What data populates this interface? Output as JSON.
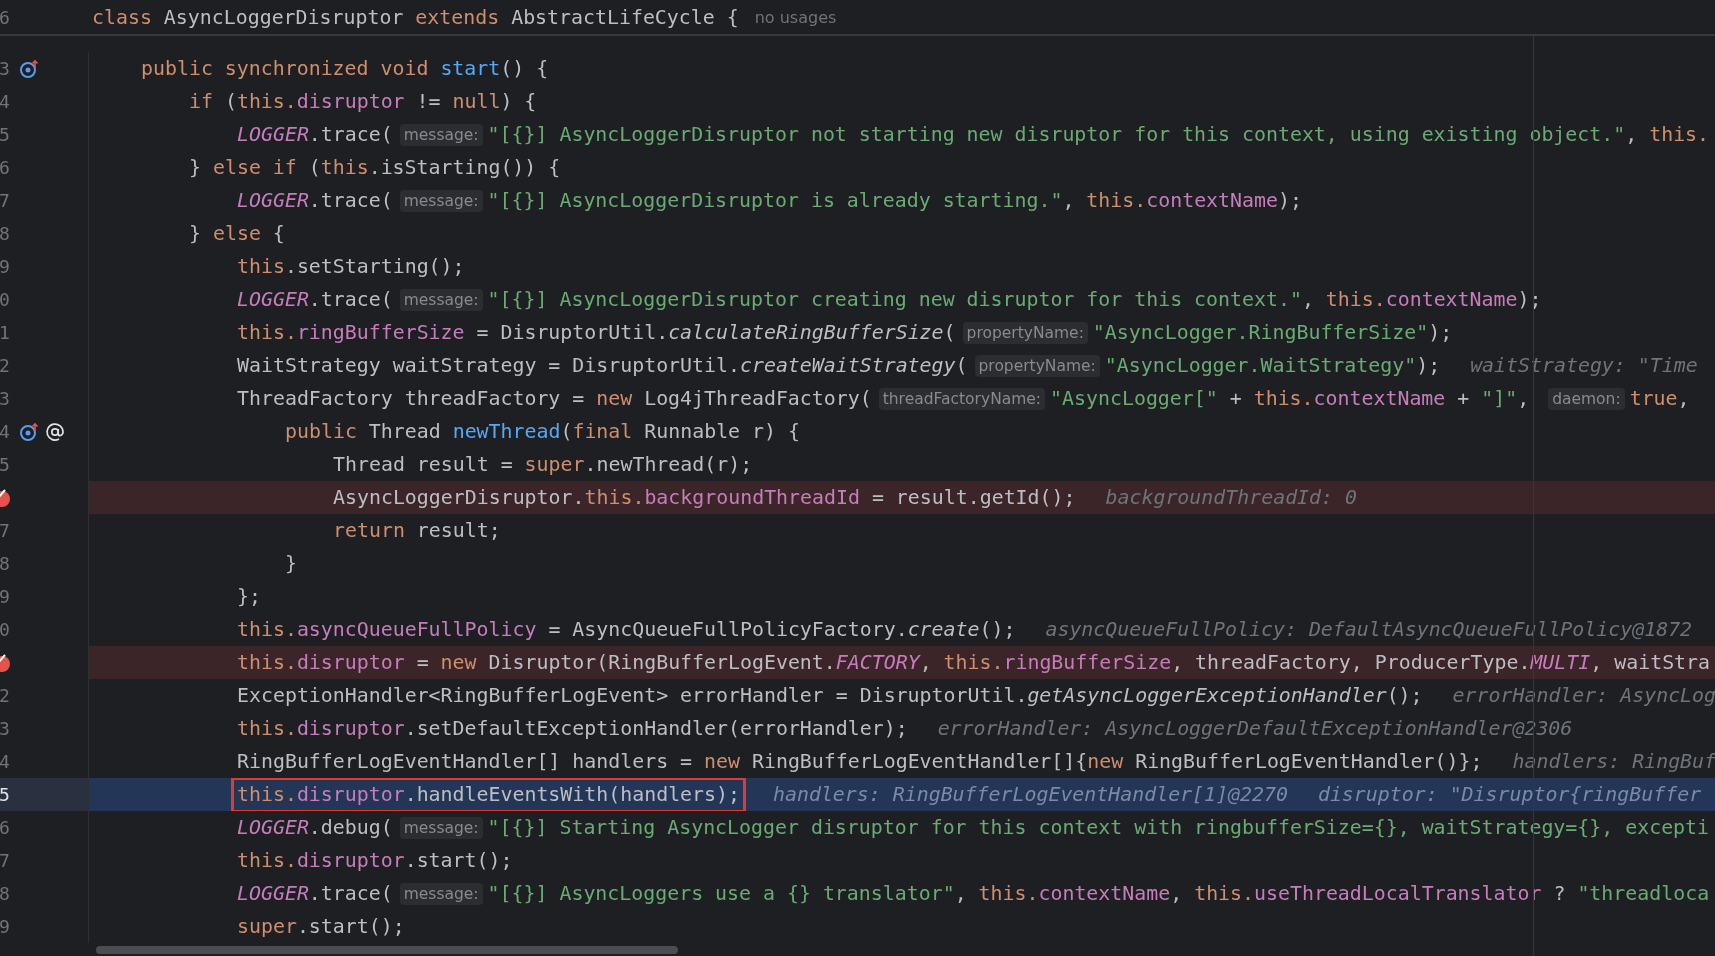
{
  "header": {
    "line_number": "6",
    "tokens": [
      {
        "kind": "kw",
        "text": "class "
      },
      {
        "kind": "p",
        "text": "AsyncLoggerDisruptor "
      },
      {
        "kind": "kw",
        "text": "extends "
      },
      {
        "kind": "p",
        "text": "AbstractLifeCycle {"
      }
    ],
    "usages": "no usages"
  },
  "rows": [
    {
      "line_number": "3",
      "breakpoint": false,
      "current": false,
      "boxed": false,
      "gutter_icons": [
        {
          "kind": "override"
        }
      ],
      "tokens": [
        {
          "kind": "kw",
          "text": "public synchronized void "
        },
        {
          "kind": "decl",
          "text": "start"
        },
        {
          "kind": "p",
          "text": "() {"
        }
      ],
      "children": [
        {
          "line_number": "4",
          "breakpoint": false,
          "current": false,
          "boxed": false,
          "tokens": [
            {
              "kind": "kw",
              "text": "if "
            },
            {
              "kind": "p",
              "text": "("
            },
            {
              "kind": "kw",
              "text": "this."
            },
            {
              "kind": "fld",
              "text": "disruptor"
            },
            {
              "kind": "p",
              "text": " != "
            },
            {
              "kind": "kw",
              "text": "null"
            },
            {
              "kind": "p",
              "text": ") {"
            }
          ],
          "children": [
            {
              "line_number": "5",
              "breakpoint": false,
              "current": false,
              "boxed": false,
              "tokens": [
                {
                  "kind": "st",
                  "text": "LOGGER"
                },
                {
                  "kind": "p",
                  "text": ".trace("
                },
                {
                  "kind": "hint",
                  "text": "message:"
                },
                {
                  "kind": "str",
                  "text": "\"[{}] AsyncLoggerDisruptor not starting new disruptor for this context, using existing object.\""
                },
                {
                  "kind": "p",
                  "text": ", "
                },
                {
                  "kind": "kw",
                  "text": "this."
                }
              ]
            }
          ]
        },
        {
          "line_number": "6",
          "breakpoint": false,
          "current": false,
          "boxed": false,
          "tokens": [
            {
              "kind": "p",
              "text": "} "
            },
            {
              "kind": "kw",
              "text": "else if "
            },
            {
              "kind": "p",
              "text": "("
            },
            {
              "kind": "kw",
              "text": "this"
            },
            {
              "kind": "p",
              "text": ".isStarting()) {"
            }
          ],
          "children": [
            {
              "line_number": "7",
              "breakpoint": false,
              "current": false,
              "boxed": false,
              "tokens": [
                {
                  "kind": "st",
                  "text": "LOGGER"
                },
                {
                  "kind": "p",
                  "text": ".trace("
                },
                {
                  "kind": "hint",
                  "text": "message:"
                },
                {
                  "kind": "str",
                  "text": "\"[{}] AsyncLoggerDisruptor is already starting.\""
                },
                {
                  "kind": "p",
                  "text": ", "
                },
                {
                  "kind": "kw",
                  "text": "this."
                },
                {
                  "kind": "fld",
                  "text": "contextName"
                },
                {
                  "kind": "p",
                  "text": ");"
                }
              ]
            }
          ]
        },
        {
          "line_number": "8",
          "breakpoint": false,
          "current": false,
          "boxed": false,
          "tokens": [
            {
              "kind": "p",
              "text": "} "
            },
            {
              "kind": "kw",
              "text": "else "
            },
            {
              "kind": "p",
              "text": "{"
            }
          ],
          "children": [
            {
              "line_number": "9",
              "breakpoint": false,
              "current": false,
              "boxed": false,
              "tokens": [
                {
                  "kind": "kw",
                  "text": "this"
                },
                {
                  "kind": "p",
                  "text": ".setStarting();"
                }
              ]
            },
            {
              "line_number": "0",
              "breakpoint": false,
              "current": false,
              "boxed": false,
              "tokens": [
                {
                  "kind": "st",
                  "text": "LOGGER"
                },
                {
                  "kind": "p",
                  "text": ".trace("
                },
                {
                  "kind": "hint",
                  "text": "message:"
                },
                {
                  "kind": "str",
                  "text": "\"[{}] AsyncLoggerDisruptor creating new disruptor for this context.\""
                },
                {
                  "kind": "p",
                  "text": ", "
                },
                {
                  "kind": "kw",
                  "text": "this."
                },
                {
                  "kind": "fld",
                  "text": "contextName"
                },
                {
                  "kind": "p",
                  "text": ");"
                }
              ]
            },
            {
              "line_number": "1",
              "breakpoint": false,
              "current": false,
              "boxed": false,
              "tokens": [
                {
                  "kind": "kw",
                  "text": "this."
                },
                {
                  "kind": "fld",
                  "text": "ringBufferSize"
                },
                {
                  "kind": "p",
                  "text": " = DisruptorUtil."
                },
                {
                  "kind": "sm",
                  "text": "calculateRingBufferSize"
                },
                {
                  "kind": "p",
                  "text": "("
                },
                {
                  "kind": "hint",
                  "text": "propertyName:"
                },
                {
                  "kind": "str",
                  "text": "\"AsyncLogger.RingBufferSize\""
                },
                {
                  "kind": "p",
                  "text": ");"
                }
              ]
            },
            {
              "line_number": "2",
              "breakpoint": false,
              "current": false,
              "boxed": false,
              "tokens": [
                {
                  "kind": "p",
                  "text": "WaitStrategy waitStrategy = DisruptorUtil."
                },
                {
                  "kind": "sm",
                  "text": "createWaitStrategy"
                },
                {
                  "kind": "p",
                  "text": "("
                },
                {
                  "kind": "hint",
                  "text": "propertyName:"
                },
                {
                  "kind": "str",
                  "text": "\"AsyncLogger.WaitStrategy\""
                },
                {
                  "kind": "p",
                  "text": ");"
                }
              ],
              "inline_values": [
                "waitStrategy: \"Time"
              ]
            },
            {
              "line_number": "3",
              "breakpoint": false,
              "current": false,
              "boxed": false,
              "tokens": [
                {
                  "kind": "p",
                  "text": "ThreadFactory threadFactory = "
                },
                {
                  "kind": "kw",
                  "text": "new "
                },
                {
                  "kind": "p",
                  "text": "Log4jThreadFactory("
                },
                {
                  "kind": "hint",
                  "text": "threadFactoryName:"
                },
                {
                  "kind": "str",
                  "text": "\"AsyncLogger[\""
                },
                {
                  "kind": "p",
                  "text": " + "
                },
                {
                  "kind": "kw",
                  "text": "this."
                },
                {
                  "kind": "fld",
                  "text": "contextName"
                },
                {
                  "kind": "p",
                  "text": " + "
                },
                {
                  "kind": "str",
                  "text": "\"]\""
                },
                {
                  "kind": "p",
                  "text": ", "
                },
                {
                  "kind": "hint",
                  "text": "daemon:"
                },
                {
                  "kind": "kw",
                  "text": "true"
                },
                {
                  "kind": "p",
                  "text": ","
                }
              ],
              "children": [
                {
                  "line_number": "4",
                  "breakpoint": false,
                  "current": false,
                  "boxed": false,
                  "gutter_icons": [
                    {
                      "kind": "override"
                    },
                    {
                      "kind": "annotation"
                    }
                  ],
                  "tokens": [
                    {
                      "kind": "kw",
                      "text": "public "
                    },
                    {
                      "kind": "p",
                      "text": "Thread "
                    },
                    {
                      "kind": "decl",
                      "text": "newThread"
                    },
                    {
                      "kind": "p",
                      "text": "("
                    },
                    {
                      "kind": "kw",
                      "text": "final "
                    },
                    {
                      "kind": "p",
                      "text": "Runnable r) {"
                    }
                  ],
                  "children": [
                    {
                      "line_number": "5",
                      "breakpoint": false,
                      "current": false,
                      "boxed": false,
                      "tokens": [
                        {
                          "kind": "p",
                          "text": "Thread result = "
                        },
                        {
                          "kind": "kw",
                          "text": "super"
                        },
                        {
                          "kind": "p",
                          "text": ".newThread(r);"
                        }
                      ]
                    },
                    {
                      "breakpoint": true,
                      "current": false,
                      "boxed": false,
                      "tokens": [
                        {
                          "kind": "p",
                          "text": "AsyncLoggerDisruptor."
                        },
                        {
                          "kind": "kw",
                          "text": "this."
                        },
                        {
                          "kind": "fld",
                          "text": "backgroundThreadId"
                        },
                        {
                          "kind": "p",
                          "text": " = result.getId();"
                        }
                      ],
                      "inline_values": [
                        "backgroundThreadId: 0"
                      ]
                    },
                    {
                      "line_number": "7",
                      "breakpoint": false,
                      "current": false,
                      "boxed": false,
                      "tokens": [
                        {
                          "kind": "kw",
                          "text": "return "
                        },
                        {
                          "kind": "p",
                          "text": "result;"
                        }
                      ]
                    }
                  ]
                },
                {
                  "line_number": "8",
                  "breakpoint": false,
                  "current": false,
                  "boxed": false,
                  "tokens": [
                    {
                      "kind": "p",
                      "text": "}"
                    }
                  ]
                }
              ]
            },
            {
              "line_number": "9",
              "breakpoint": false,
              "current": false,
              "boxed": false,
              "tokens": [
                {
                  "kind": "p",
                  "text": "};"
                }
              ]
            },
            {
              "line_number": "0",
              "breakpoint": false,
              "current": false,
              "boxed": false,
              "tokens": [
                {
                  "kind": "kw",
                  "text": "this."
                },
                {
                  "kind": "fld",
                  "text": "asyncQueueFullPolicy"
                },
                {
                  "kind": "p",
                  "text": " = AsyncQueueFullPolicyFactory."
                },
                {
                  "kind": "sm",
                  "text": "create"
                },
                {
                  "kind": "p",
                  "text": "();"
                }
              ],
              "inline_values": [
                "asyncQueueFullPolicy: DefaultAsyncQueueFullPolicy@1872"
              ]
            },
            {
              "breakpoint": true,
              "current": false,
              "boxed": false,
              "tokens": [
                {
                  "kind": "kw",
                  "text": "this."
                },
                {
                  "kind": "fld",
                  "text": "disruptor"
                },
                {
                  "kind": "p",
                  "text": " = "
                },
                {
                  "kind": "kw",
                  "text": "new "
                },
                {
                  "kind": "p",
                  "text": "Disruptor(RingBufferLogEvent."
                },
                {
                  "kind": "st",
                  "text": "FACTORY"
                },
                {
                  "kind": "p",
                  "text": ", "
                },
                {
                  "kind": "kw",
                  "text": "this."
                },
                {
                  "kind": "fld",
                  "text": "ringBufferSize"
                },
                {
                  "kind": "p",
                  "text": ", threadFactory, ProducerType."
                },
                {
                  "kind": "st",
                  "text": "MULTI"
                },
                {
                  "kind": "p",
                  "text": ", waitStra"
                }
              ]
            },
            {
              "line_number": "2",
              "breakpoint": false,
              "current": false,
              "boxed": false,
              "tokens": [
                {
                  "kind": "p",
                  "text": "ExceptionHandler<RingBufferLogEvent> errorHandler = DisruptorUtil."
                },
                {
                  "kind": "sm",
                  "text": "getAsyncLoggerExceptionHandler"
                },
                {
                  "kind": "p",
                  "text": "();"
                }
              ],
              "inline_values": [
                "errorHandler: AsyncLog"
              ]
            },
            {
              "line_number": "3",
              "breakpoint": false,
              "current": false,
              "boxed": false,
              "tokens": [
                {
                  "kind": "kw",
                  "text": "this."
                },
                {
                  "kind": "fld",
                  "text": "disruptor"
                },
                {
                  "kind": "p",
                  "text": ".setDefaultExceptionHandler(errorHandler);"
                }
              ],
              "inline_values": [
                "errorHandler: AsyncLoggerDefaultExceptionHandler@2306"
              ]
            },
            {
              "line_number": "4",
              "breakpoint": false,
              "current": false,
              "boxed": false,
              "tokens": [
                {
                  "kind": "p",
                  "text": "RingBufferLogEventHandler[] handlers = "
                },
                {
                  "kind": "kw",
                  "text": "new "
                },
                {
                  "kind": "p",
                  "text": "RingBufferLogEventHandler[]{"
                },
                {
                  "kind": "kw",
                  "text": "new "
                },
                {
                  "kind": "p",
                  "text": "RingBufferLogEventHandler()};"
                }
              ],
              "inline_values": [
                "handlers: RingBuf"
              ]
            },
            {
              "line_number": "5",
              "breakpoint": false,
              "current": true,
              "boxed": true,
              "tokens": [
                {
                  "kind": "kw",
                  "text": "this."
                },
                {
                  "kind": "fld",
                  "text": "disruptor"
                },
                {
                  "kind": "p",
                  "text": ".handleEventsWith(handlers);"
                }
              ],
              "inline_values": [
                "handlers: RingBufferLogEventHandler[1]@2270",
                "disruptor: \"Disruptor{ringBuffer"
              ]
            },
            {
              "line_number": "6",
              "breakpoint": false,
              "current": false,
              "boxed": false,
              "tokens": [
                {
                  "kind": "st",
                  "text": "LOGGER"
                },
                {
                  "kind": "p",
                  "text": ".debug("
                },
                {
                  "kind": "hint",
                  "text": "message:"
                },
                {
                  "kind": "str",
                  "text": "\"[{}] Starting AsyncLogger disruptor for this context with ringbufferSize={}, waitStrategy={}, excepti"
                }
              ]
            },
            {
              "line_number": "7",
              "breakpoint": false,
              "current": false,
              "boxed": false,
              "tokens": [
                {
                  "kind": "kw",
                  "text": "this."
                },
                {
                  "kind": "fld",
                  "text": "disruptor"
                },
                {
                  "kind": "p",
                  "text": ".start();"
                }
              ]
            },
            {
              "line_number": "8",
              "breakpoint": false,
              "current": false,
              "boxed": false,
              "tokens": [
                {
                  "kind": "st",
                  "text": "LOGGER"
                },
                {
                  "kind": "p",
                  "text": ".trace("
                },
                {
                  "kind": "hint",
                  "text": "message:"
                },
                {
                  "kind": "str",
                  "text": "\"[{}] AsyncLoggers use a {} translator\""
                },
                {
                  "kind": "p",
                  "text": ", "
                },
                {
                  "kind": "kw",
                  "text": "this."
                },
                {
                  "kind": "fld",
                  "text": "contextName"
                },
                {
                  "kind": "p",
                  "text": ", "
                },
                {
                  "kind": "kw",
                  "text": "this."
                },
                {
                  "kind": "fld",
                  "text": "useThreadLocalTranslator"
                },
                {
                  "kind": "p",
                  "text": " ? "
                },
                {
                  "kind": "str",
                  "text": "\"threadloca"
                }
              ]
            },
            {
              "line_number": "9",
              "breakpoint": false,
              "current": false,
              "boxed": false,
              "tokens": [
                {
                  "kind": "kw",
                  "text": "super"
                },
                {
                  "kind": "p",
                  "text": ".start();"
                }
              ]
            }
          ]
        }
      ]
    }
  ]
}
